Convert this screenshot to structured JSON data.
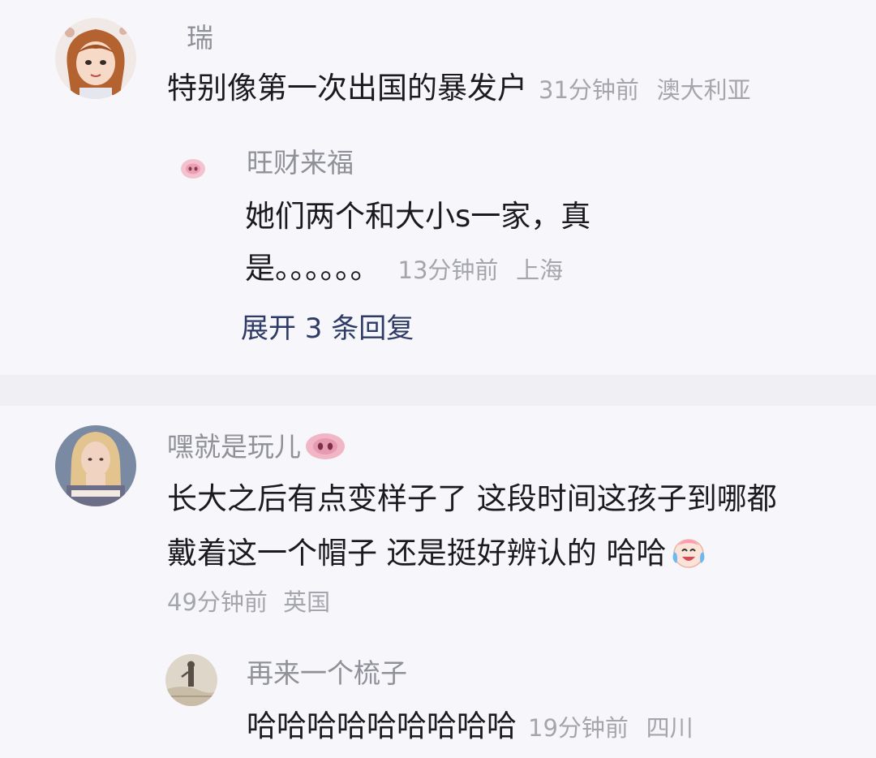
{
  "comments": [
    {
      "username": "瑞",
      "text": "特别像第一次出国的暴发户",
      "time": "31分钟前",
      "location": "澳大利亚",
      "avatar_icon": "cartoon-girl-avatar",
      "replies": [
        {
          "username": "旺财来福",
          "avatar_icon": "pig-nose-avatar",
          "text_line1": "她们两个和大小s一家，真",
          "text_line2": "是。。。。。。",
          "time": "13分钟前",
          "location": "上海"
        }
      ],
      "expand_label": "展开 3 条回复"
    },
    {
      "username": "嘿就是玩儿",
      "username_icon": "pig-nose-icon",
      "avatar_icon": "blonde-woman-avatar",
      "text_line1": "长大之后有点变样子了 这段时间这孩子到哪都",
      "text_line2": "戴着这一个帽子 还是挺好辨认的 哈哈",
      "text_emoji": "laughing-crying-emoji",
      "time": "49分钟前",
      "location": "英国",
      "replies": [
        {
          "username": "再来一个梳子",
          "avatar_icon": "sketch-figure-avatar",
          "text": "哈哈哈哈哈哈哈哈哈",
          "time": "19分钟前",
          "location": "四川"
        }
      ]
    }
  ],
  "colors": {
    "background": "#f7f6fb",
    "username": "#8f9098",
    "meta": "#a5a6ad",
    "expand_link": "#2d3b66"
  }
}
